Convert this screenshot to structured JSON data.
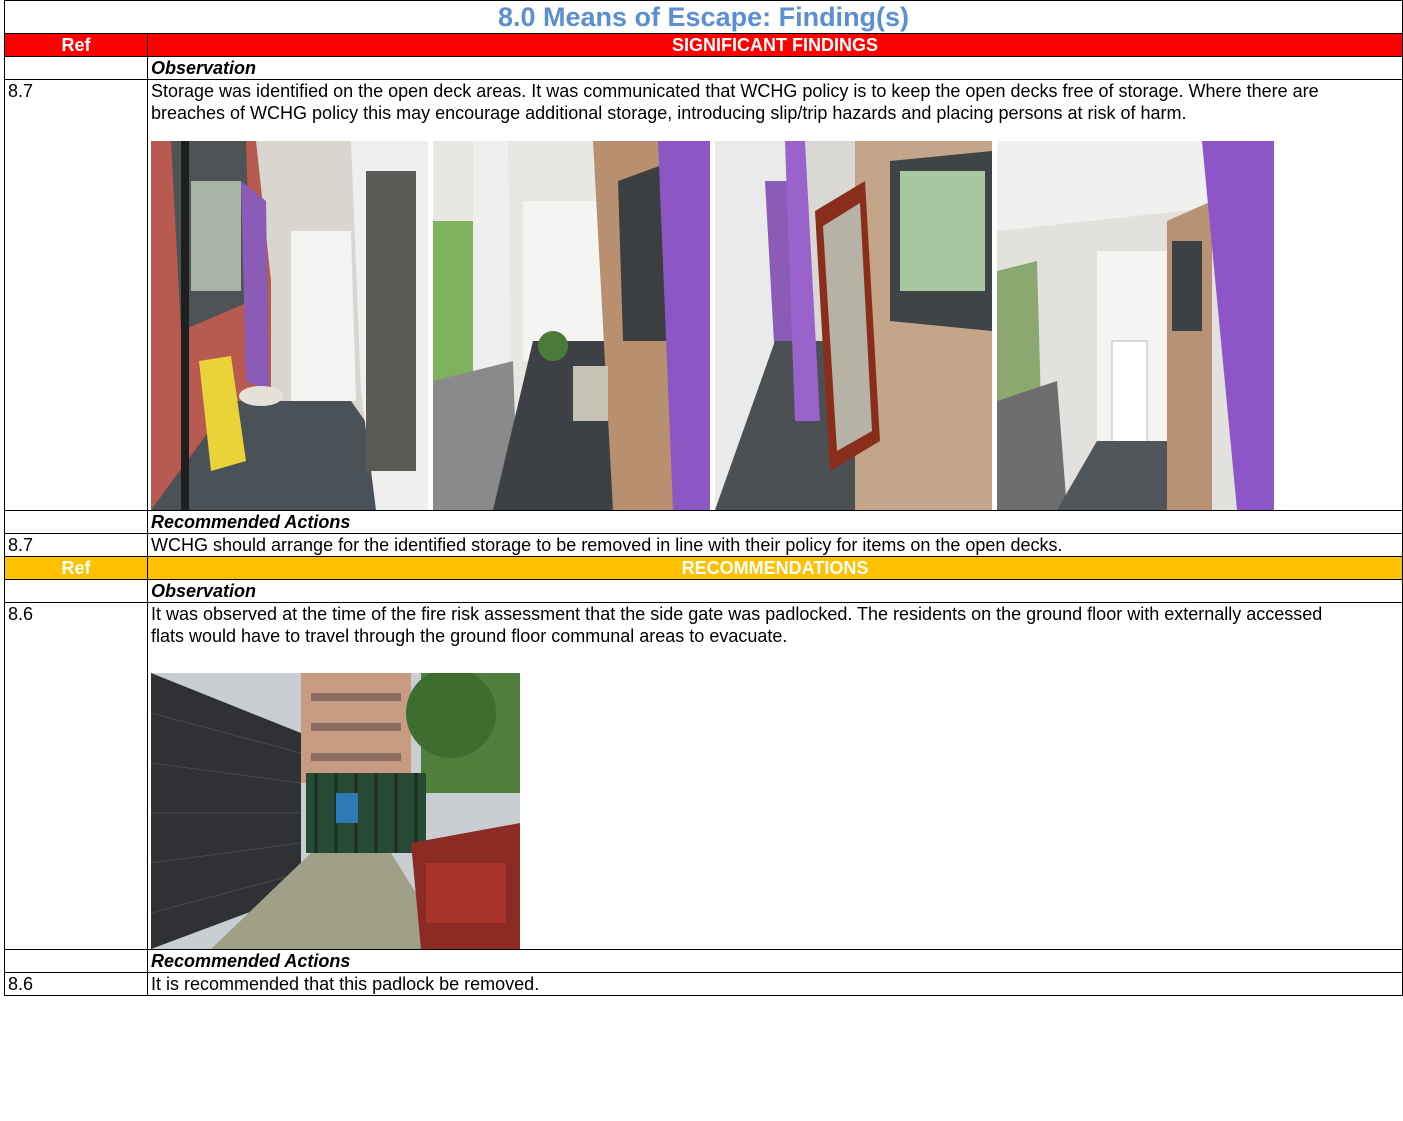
{
  "title": "8.0 Means of Escape: Finding(s)",
  "significant": {
    "ref_header": "Ref",
    "section_header": "SIGNIFICANT FINDINGS",
    "observation_label": "Observation",
    "observation_ref": "8.7",
    "observation_text": "Storage was identified on the open deck areas. It was communicated that WCHG policy is to keep the open decks free of storage. Where there are breaches of WCHG policy this may encourage additional storage, introducing slip/trip hazards and placing persons at risk of harm.",
    "actions_label": "Recommended Actions",
    "actions_ref": "8.7",
    "actions_text": "WCHG should arrange for the identified storage to be removed in line with their policy for items on the open decks."
  },
  "recommendations": {
    "ref_header": "Ref",
    "section_header": "RECOMMENDATIONS",
    "observation_label": "Observation",
    "observation_ref": "8.6",
    "observation_text": "It was observed at the time of the fire risk assessment that the side gate was padlocked. The residents on the ground floor with externally accessed flats would have to travel through the ground floor communal areas to evacuate.",
    "actions_label": "Recommended Actions",
    "actions_ref": "8.6",
    "actions_text": "It is recommended that this padlock be removed."
  },
  "colors": {
    "title": "#5b8fd1",
    "significant_header": "#ff0000",
    "recommendations_header": "#ffc000"
  }
}
